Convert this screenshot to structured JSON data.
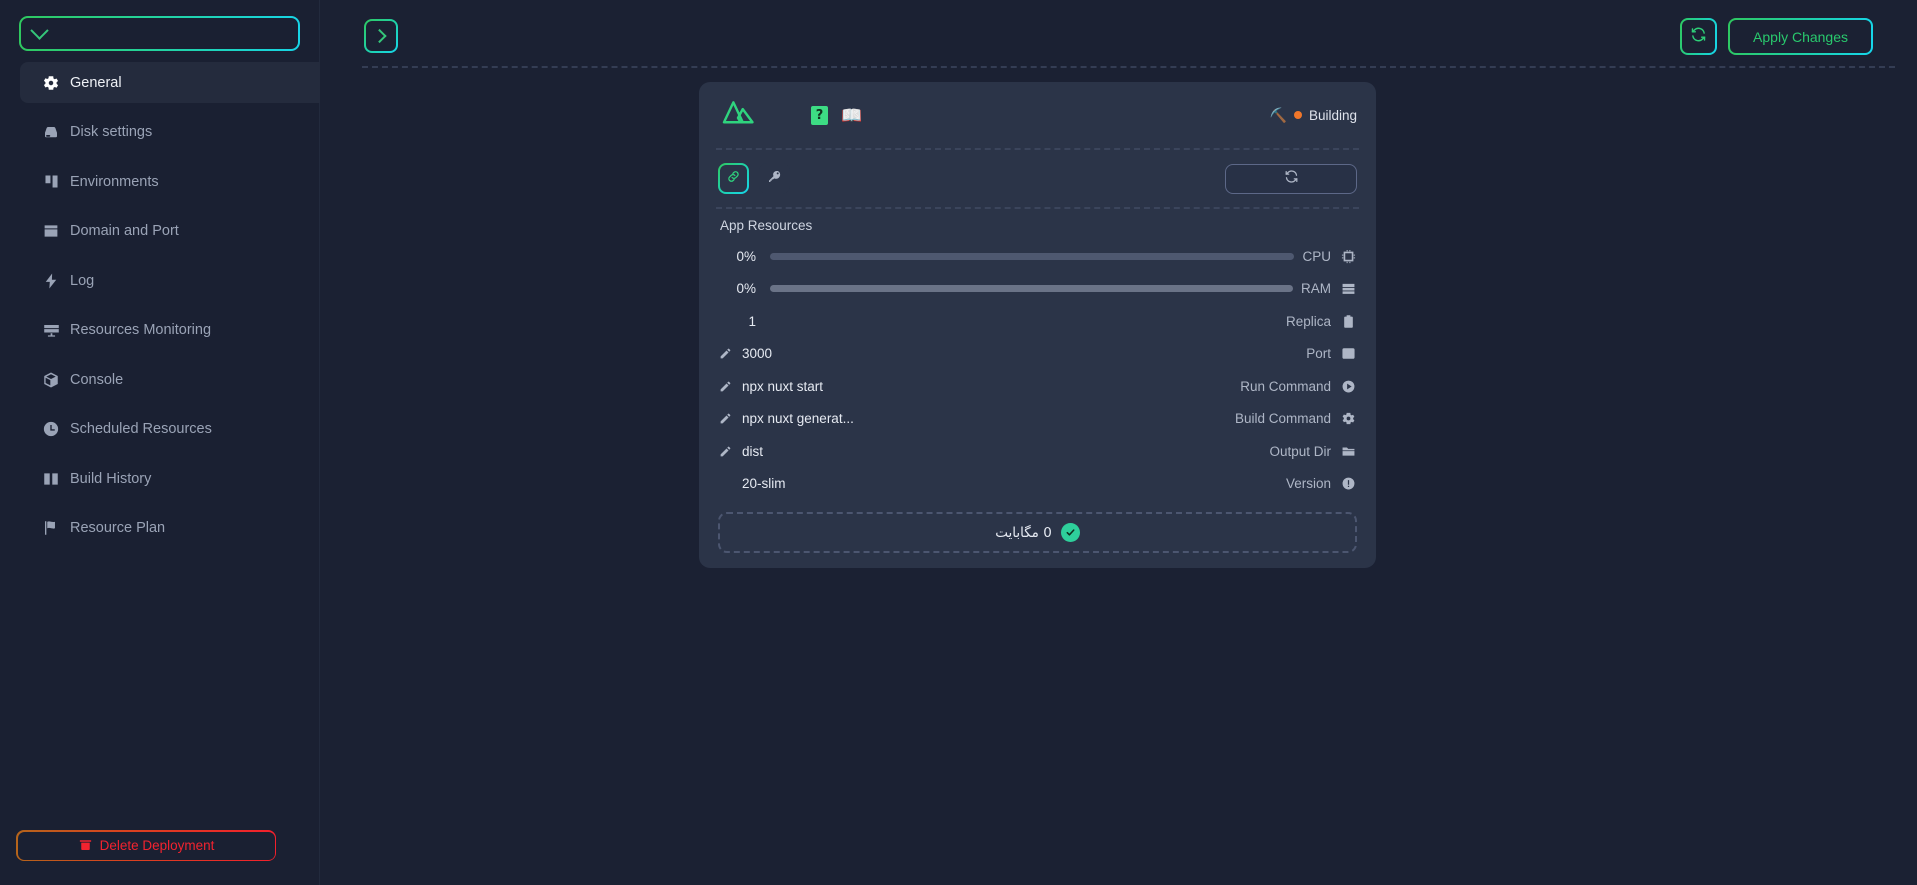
{
  "sidebar": {
    "project_select": {
      "value": "",
      "placeholder": ""
    },
    "items": [
      {
        "label": "General",
        "icon": "gear-icon",
        "active": true
      },
      {
        "label": "Disk settings",
        "icon": "hard-drive-icon",
        "active": false
      },
      {
        "label": "Environments",
        "icon": "environments-icon",
        "active": false
      },
      {
        "label": "Domain and Port",
        "icon": "browser-window-icon",
        "active": false
      },
      {
        "label": "Log",
        "icon": "lightning-bolt-icon",
        "active": false
      },
      {
        "label": "Resources Monitoring",
        "icon": "monitor-icon",
        "active": false
      },
      {
        "label": "Console",
        "icon": "cube-icon",
        "active": false
      },
      {
        "label": "Scheduled Resources",
        "icon": "clock-icon",
        "active": false
      },
      {
        "label": "Build History",
        "icon": "book-icon",
        "active": false
      },
      {
        "label": "Resource Plan",
        "icon": "flag-icon",
        "active": false
      }
    ],
    "delete_button": {
      "label": "Delete Deployment",
      "icon": "trash-x-icon",
      "color": "#f2232f"
    }
  },
  "topbar": {
    "collapse_icon": "chevron-right-icon",
    "refresh_icon": "refresh-icon",
    "apply_label": "Apply Changes",
    "accent_from": "#2fc85f",
    "accent_to": "#16d6ec"
  },
  "card": {
    "header": {
      "logo": "nuxt-logo",
      "help_badge": "?",
      "docs_icon": "open-book-icon",
      "status_icon": "pickaxe-icon",
      "status_label": "Building",
      "status_color": "#f0762a"
    },
    "tools": {
      "link_icon": "link-icon",
      "key_icon": "key-icon",
      "refresh_icon": "refresh-icon"
    },
    "resources_title": "App Resources",
    "resources": [
      {
        "value": "0%",
        "label": "CPU",
        "icon": "cpu-chip-icon",
        "bar": true,
        "percent": 0
      },
      {
        "value": "0%",
        "label": "RAM",
        "icon": "server-icon",
        "bar": true,
        "percent": 0
      },
      {
        "value": "1",
        "label": "Replica",
        "icon": "clipboard-icon",
        "bar": false,
        "percent": null
      }
    ],
    "details": [
      {
        "value": "3000",
        "label": "Port",
        "icon": "browser-window-icon",
        "editable": true
      },
      {
        "value": "npx nuxt start",
        "label": "Run Command",
        "icon": "play-circle-icon",
        "editable": true
      },
      {
        "value": "npx nuxt generat...",
        "label": "Build Command",
        "icon": "gear-icon",
        "editable": true
      },
      {
        "value": "dist",
        "label": "Output Dir",
        "icon": "folder-icon",
        "editable": true
      },
      {
        "value": "20-slim",
        "label": "Version",
        "icon": "info-circle-icon",
        "editable": false
      }
    ],
    "footer": {
      "icon": "check-circle-icon",
      "text": "0 مگابایت"
    }
  }
}
